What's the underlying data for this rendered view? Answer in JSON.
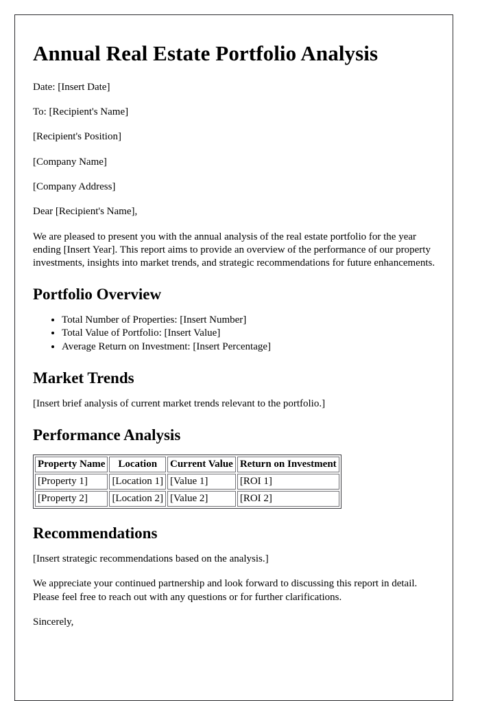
{
  "document": {
    "title": "Annual Real Estate Portfolio Analysis",
    "meta": {
      "date_line": "Date: [Insert Date]",
      "to_line": "To: [Recipient's Name]",
      "recipient_position": "[Recipient's Position]",
      "company_name": "[Company Name]",
      "company_address": "[Company Address]"
    },
    "salutation": "Dear [Recipient's Name],",
    "intro_paragraph": "We are pleased to present you with the annual analysis of the real estate portfolio for the year ending [Insert Year]. This report aims to provide an overview of the performance of our property investments, insights into market trends, and strategic recommendations for future enhancements.",
    "sections": {
      "portfolio_overview": {
        "heading": "Portfolio Overview",
        "items": [
          "Total Number of Properties: [Insert Number]",
          "Total Value of Portfolio: [Insert Value]",
          "Average Return on Investment: [Insert Percentage]"
        ]
      },
      "market_trends": {
        "heading": "Market Trends",
        "body": "[Insert brief analysis of current market trends relevant to the portfolio.]"
      },
      "performance_analysis": {
        "heading": "Performance Analysis",
        "table": {
          "columns": [
            "Property Name",
            "Location",
            "Current Value",
            "Return on Investment"
          ],
          "rows": [
            [
              "[Property 1]",
              "[Location 1]",
              "[Value 1]",
              "[ROI 1]"
            ],
            [
              "[Property 2]",
              "[Location 2]",
              "[Value 2]",
              "[ROI 2]"
            ]
          ]
        }
      },
      "recommendations": {
        "heading": "Recommendations",
        "body": "[Insert strategic recommendations based on the analysis.]"
      }
    },
    "closing_paragraph": "We appreciate your continued partnership and look forward to discussing this report in detail. Please feel free to reach out with any questions or for further clarifications.",
    "sign_off": "Sincerely,"
  },
  "colors": {
    "page_background": "#ffffff",
    "page_border": "#2b2b2e",
    "text": "#000000",
    "table_outer_border": "#3a3a3e",
    "table_cell_border": "#6f6f74"
  }
}
